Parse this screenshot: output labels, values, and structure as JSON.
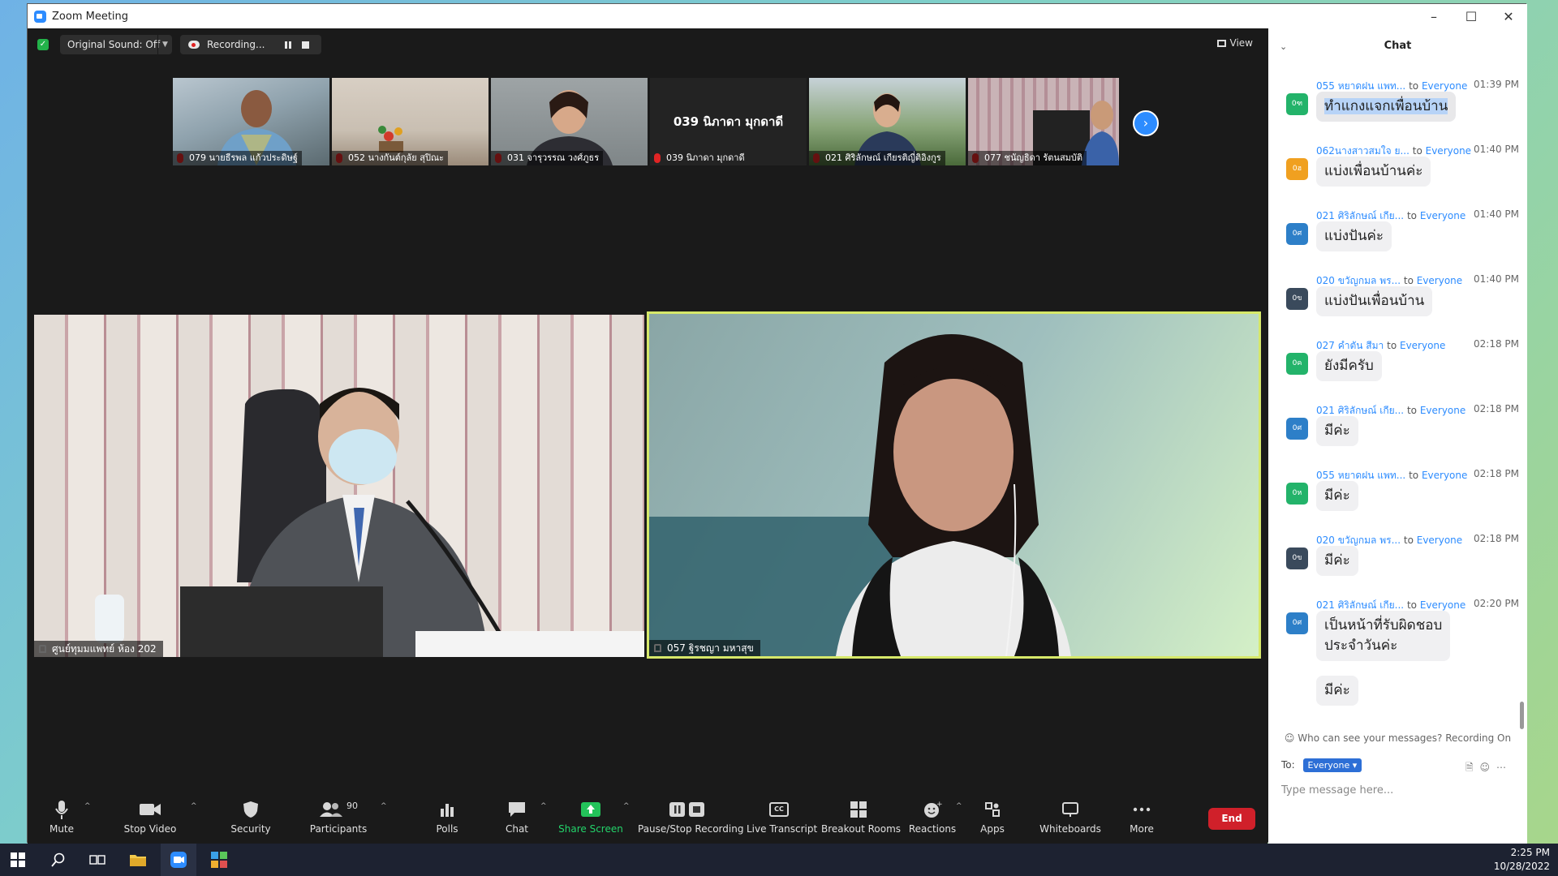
{
  "window": {
    "title": "Zoom Meeting"
  },
  "topbar": {
    "original_sound": "Original Sound: Off",
    "recording": "Recording...",
    "view": "View"
  },
  "thumbnails": [
    {
      "name": "079 นายธีรพล แก้วประดิษฐ์"
    },
    {
      "name": "052 นางกันต์กุลัย สุปิณะ"
    },
    {
      "name": "031 จารุวรรณ วงศ์ภูธร"
    },
    {
      "name": "039 นิภาดา มุกดาดี",
      "big": "039 นิภาดา มุกดาดี"
    },
    {
      "name": "021 ศิริลักษณ์ เกียรติญี่ติอิงกูร"
    },
    {
      "name": "077 ชนัญธิดา รัตนสมบัติ"
    }
  ],
  "tiles": {
    "left": "ศูนย์ทุมมแพทย์ ห้อง 202",
    "right": "057 ฐิรชญา มหาสุข"
  },
  "toolbar": {
    "mute": "Mute",
    "stop_video": "Stop Video",
    "security": "Security",
    "participants": "Participants",
    "participants_count": "90",
    "polls": "Polls",
    "chat": "Chat",
    "share_screen": "Share Screen",
    "pause_stop_recording": "Pause/Stop Recording",
    "live_transcript": "Live Transcript",
    "breakout_rooms": "Breakout Rooms",
    "reactions": "Reactions",
    "apps": "Apps",
    "whiteboards": "Whiteboards",
    "more": "More",
    "end": "End",
    "cc": "CC"
  },
  "chat": {
    "title": "Chat",
    "messages": [
      {
        "sender": "055 หยาดฝน แพท...",
        "to": "to",
        "recipient": "Everyone",
        "time": "01:39 PM",
        "text": "ทำแกงแจกเพื่อนบ้าน",
        "avatar": "0ฑ",
        "color": "#23b36a"
      },
      {
        "sender": "062นางสาวสมใจ ย...",
        "to": "to",
        "recipient": "Everyone",
        "time": "01:40 PM",
        "text": "แบ่งเพื่อนบ้านค่ะ",
        "avatar": "0ฮ",
        "color": "#f0a020"
      },
      {
        "sender": "021 ศิริลักษณ์ เกีย...",
        "to": "to",
        "recipient": "Everyone",
        "time": "01:40 PM",
        "text": "แบ่งปันค่ะ",
        "avatar": "0ศ",
        "color": "#2d7fc8"
      },
      {
        "sender": "020 ขวัญกมล พร...",
        "to": "to",
        "recipient": "Everyone",
        "time": "01:40 PM",
        "text": "แบ่งปันเพื่อนบ้าน",
        "avatar": "0ข",
        "color": "#3a4a5c"
      },
      {
        "sender": "027 คำตัน สีมา",
        "to": "to",
        "recipient": "Everyone",
        "time": "02:18 PM",
        "text": "ยังมีครับ",
        "avatar": "0ค",
        "color": "#23b36a"
      },
      {
        "sender": "021 ศิริลักษณ์ เกีย...",
        "to": "to",
        "recipient": "Everyone",
        "time": "02:18 PM",
        "text": "มีค่ะ",
        "avatar": "0ศ",
        "color": "#2d7fc8"
      },
      {
        "sender": "055 หยาดฝน แพท...",
        "to": "to",
        "recipient": "Everyone",
        "time": "02:18 PM",
        "text": "มีค่ะ",
        "avatar": "0ห",
        "color": "#23b36a"
      },
      {
        "sender": "020 ขวัญกมล พร...",
        "to": "to",
        "recipient": "Everyone",
        "time": "02:18 PM",
        "text": "มีค่ะ",
        "avatar": "0ข",
        "color": "#3a4a5c"
      },
      {
        "sender": "021 ศิริลักษณ์ เกีย...",
        "to": "to",
        "recipient": "Everyone",
        "time": "02:20 PM",
        "text": "เป็นหน้าที่รับผิดชอบ",
        "text2": "ประจำวันค่ะ",
        "text3": "มีค่ะ",
        "avatar": "0ศ",
        "color": "#2d7fc8"
      }
    ],
    "privacy": "Who can see your messages? Recording On",
    "to_label": "To:",
    "to_value": "Everyone",
    "placeholder": "Type message here..."
  },
  "taskbar": {
    "time": "2:25 PM",
    "date": "10/28/2022"
  }
}
